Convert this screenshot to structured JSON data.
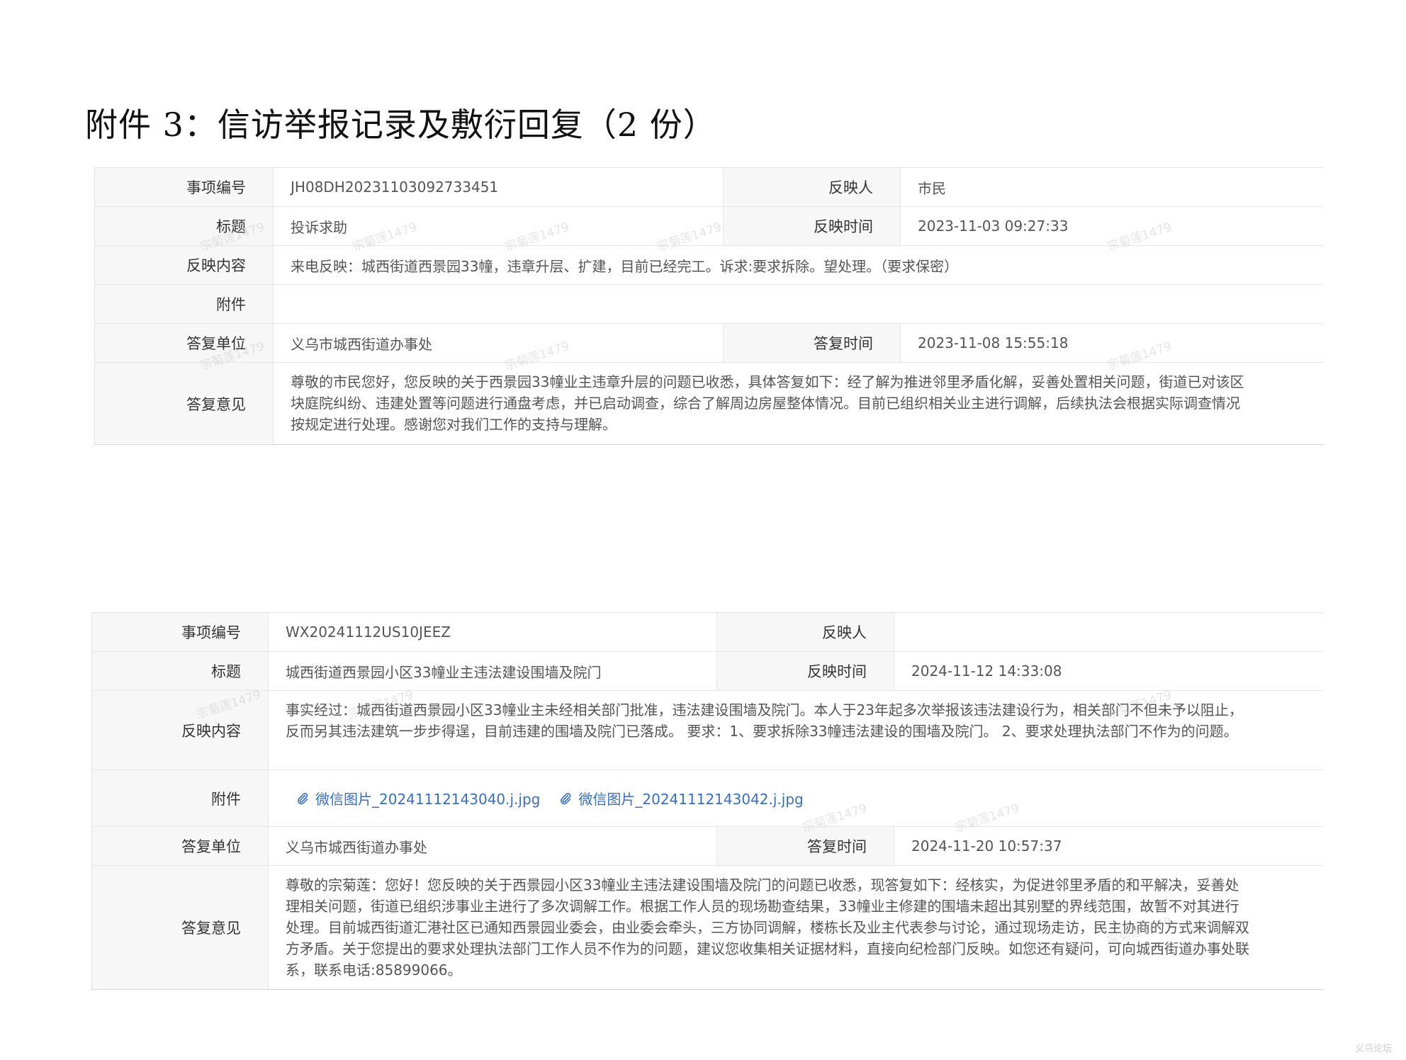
{
  "page_title": "附件 3：信访举报记录及敷衍回复（2 份）",
  "records": [
    {
      "item_no_label": "事项编号",
      "item_no": "JH08DH20231103092733451",
      "reporter_label": "反映人",
      "reporter": "市民",
      "title_label": "标题",
      "title": "投诉求助",
      "report_time_label": "反映时间",
      "report_time": "2023-11-03 09:27:33",
      "content_label": "反映内容",
      "content": "来电反映：城西街道西景园33幢，违章升层、扩建，目前已经完工。诉求:要求拆除。望处理。（要求保密）",
      "attachment_label": "附件",
      "reply_unit_label": "答复单位",
      "reply_unit": "义乌市城西街道办事处",
      "reply_time_label": "答复时间",
      "reply_time": "2023-11-08 15:55:18",
      "reply_opinion_label": "答复意见",
      "reply_opinion": "尊敬的市民您好，您反映的关于西景园33幢业主违章升层的问题已收悉，具体答复如下：经了解为推进邻里矛盾化解，妥善处置相关问题，街道已对该区块庭院纠纷、违建处置等问题进行通盘考虑，并已启动调查，综合了解周边房屋整体情况。目前已组织相关业主进行调解，后续执法会根据实际调查情况按规定进行处理。感谢您对我们工作的支持与理解。"
    },
    {
      "item_no_label": "事项编号",
      "item_no": "WX20241112US10JEEZ",
      "reporter_label": "反映人",
      "reporter": "",
      "title_label": "标题",
      "title": "城西街道西景园小区33幢业主违法建设围墙及院门",
      "report_time_label": "反映时间",
      "report_time": "2024-11-12 14:33:08",
      "content_label": "反映内容",
      "content": "事实经过：城西街道西景园小区33幢业主未经相关部门批准，违法建设围墙及院门。本人于23年起多次举报该违法建设行为，相关部门不但未予以阻止，反而另其违法建筑一步步得逞，目前违建的围墙及院门已落成。 要求：1、要求拆除33幢违法建设的围墙及院门。 2、要求处理执法部门不作为的问题。",
      "attachment_label": "附件",
      "attachments": [
        "微信图片_20241112143040.j.jpg",
        "微信图片_20241112143042.j.jpg"
      ],
      "reply_unit_label": "答复单位",
      "reply_unit": "义乌市城西街道办事处",
      "reply_time_label": "答复时间",
      "reply_time": "2024-11-20 10:57:37",
      "reply_opinion_label": "答复意见",
      "reply_opinion": "尊敬的宗菊莲：您好！您反映的关于西景园小区33幢业主违法建设围墙及院门的问题已收悉，现答复如下：经核实，为促进邻里矛盾的和平解决，妥善处理相关问题，街道已组织涉事业主进行了多次调解工作。根据工作人员的现场勘查结果，33幢业主修建的围墙未超出其别墅的界线范围，故暂不对其进行处理。目前城西街道汇港社区已通知西景园业委会，由业委会牵头，三方协同调解，楼栋长及业主代表参与讨论，通过现场走访，民主协商的方式来调解双方矛盾。关于您提出的要求处理执法部门工作人员不作为的问题，建议您收集相关证据材料，直接向纪检部门反映。如您还有疑问，可向城西街道办事处联系，联系电话:85899066。"
    }
  ],
  "watermark_text": "宗菊莲1479",
  "corner_logo_text": "义乌论坛",
  "colors": {
    "label_bg": "#f7f7f7",
    "border": "#e6e6e6",
    "link": "#3a6fb7"
  }
}
